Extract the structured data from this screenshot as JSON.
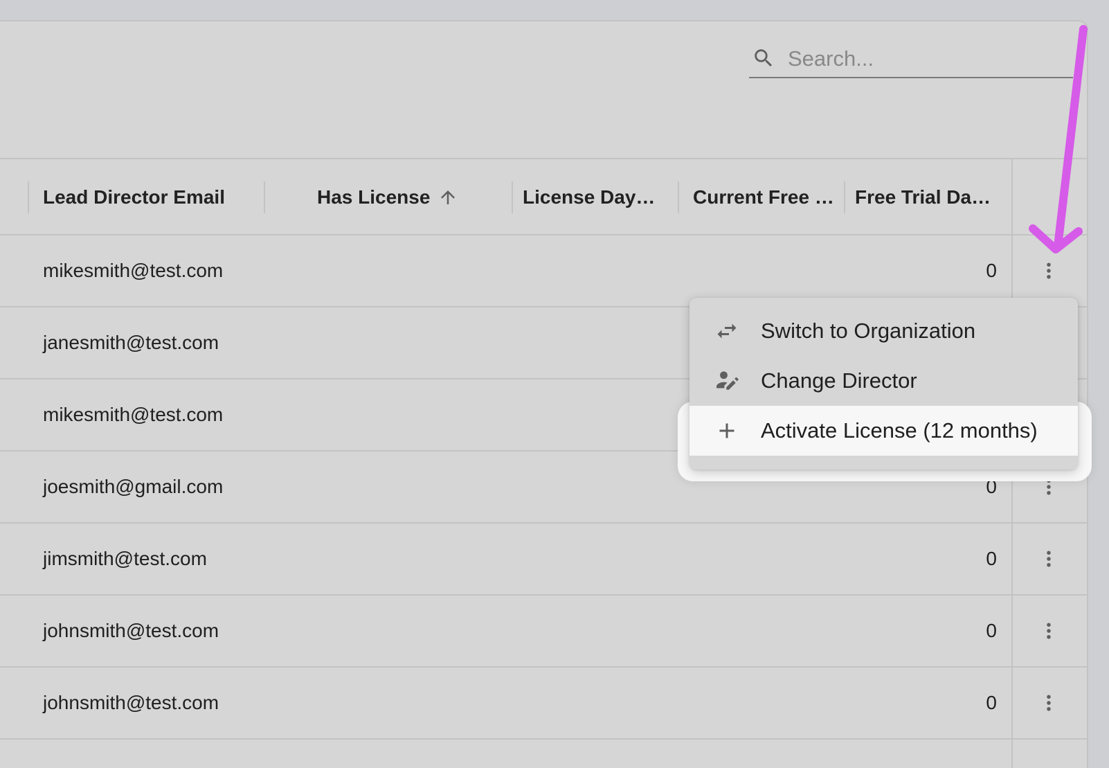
{
  "search": {
    "placeholder": "Search..."
  },
  "table": {
    "columns": [
      {
        "label": "Lead Director Email"
      },
      {
        "label": "Has License",
        "sort": "ascending"
      },
      {
        "label": "License Days ..."
      },
      {
        "label": "Current Free T..."
      },
      {
        "label": "Free Trial Day..."
      }
    ],
    "rows": [
      {
        "email": "mikesmith@test.com",
        "free_trial_days": "0"
      },
      {
        "email": "janesmith@test.com",
        "free_trial_days": ""
      },
      {
        "email": "mikesmith@test.com",
        "free_trial_days": ""
      },
      {
        "email": "joesmith@gmail.com",
        "free_trial_days": "0"
      },
      {
        "email": "jimsmith@test.com",
        "free_trial_days": "0"
      },
      {
        "email": "johnsmith@test.com",
        "free_trial_days": "0"
      },
      {
        "email": "johnsmith@test.com",
        "free_trial_days": "0"
      }
    ]
  },
  "menu": {
    "items": [
      {
        "label": "Switch to Organization",
        "icon": "swap-horiz-icon"
      },
      {
        "label": "Change Director",
        "icon": "person-edit-icon"
      },
      {
        "label": "Activate License (12 months)",
        "icon": "plus-icon"
      }
    ]
  },
  "colors": {
    "background": "#cdcfd3",
    "panel": "#d6d6d6",
    "highlight": "#f7f7f7",
    "annotation_arrow": "#d65be8",
    "text": "#1f1f1f",
    "icon": "#5f5f5f"
  }
}
